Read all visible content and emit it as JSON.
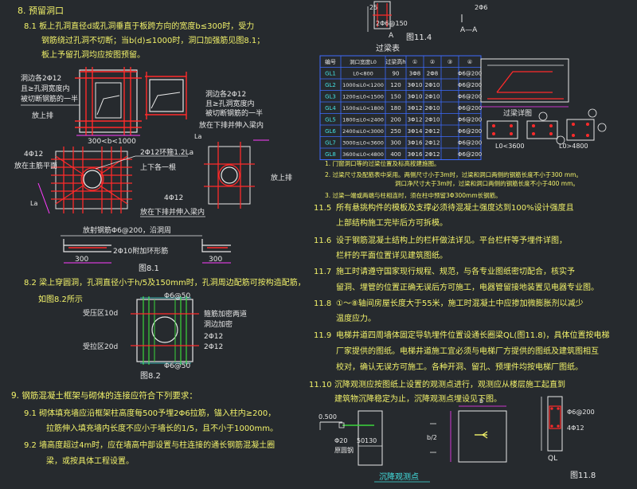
{
  "colors": {
    "background": "#262a2e",
    "rebar": "#ff2a2a",
    "outline": "#e8e8e8",
    "dimension": "#ff3dff",
    "note_text": "#f2f26a",
    "table_border": "#3d6bff",
    "cyan": "#43e0e0",
    "green": "#3bd63b"
  },
  "section8": {
    "title": "8.  预留洞口",
    "p81_line1": "8.1   板上孔洞直径d或孔洞垂直于板跨方向的宽度b≤300时，受力",
    "p81_line2": "钢筋绕过孔洞不切断；当b(d)≤1000时，洞口加强筋见图8.1；",
    "p81_line3": "板上予留孔洞均应按图预留。",
    "fig81_label_left1": "洞边各2Φ12",
    "fig81_label_left2": "且≥孔洞宽度内",
    "fig81_label_left3": "被切断钢筋的一半",
    "fig81_label_left4": "放上排",
    "fig81_label_right1": "洞边各2Φ12",
    "fig81_label_right2": "且≥孔洞宽度内",
    "fig81_label_right3": "被切断钢筋的一半",
    "fig81_label_right4": "放在下排并伸入梁内",
    "fig81_dim1": "300<b<1000",
    "fig81_ring": "2Φ12环箍1.2La",
    "fig81_up_down": "上下各一根",
    "fig81_4phi12_left": "4Φ12",
    "fig81_left_side": "放在主筋平面",
    "fig81_4phi12_right": "4Φ12",
    "fig81_right_side": "放在下排并伸入梁内",
    "fig81_upper": "放上排",
    "fig81_la": "La",
    "fig81_bottom_note1": "放射钢筋Φ6@200，沿洞周",
    "fig81_bottom_note2": "2Φ10附加环形筋",
    "fig81_dim300a": "300",
    "fig81_dim300b": "300",
    "fig81_caption": "图8.1",
    "p82_line1": "8.2   梁上穿圆洞，孔洞直径小于h/5及150mm时，孔洞周边配筋可按构造配筋，",
    "p82_line2": "如图8.2所示",
    "fig82_top": "Φ6@50",
    "fig82_mid1": "箍筋加密两道",
    "fig82_mid2": "洞边加密",
    "fig82_compression": "受压区10d",
    "fig82_tension": "受拉区20d",
    "fig82_2phi12": "2Φ12",
    "fig82_bottom": "Φ6@50",
    "fig82_caption": "图8.2"
  },
  "section9": {
    "title": "9.  钢筋混凝土框架与砌体的连接应符合下列要求：",
    "p91_line1": "9.1     砌体填充墙应沿框架柱高度每500予埋2Φ6拉筋，锚入柱内≥200，",
    "p91_line2": "拉筋伸入填充墙内长度不应小于墙长的1/5，且不小于1000mm。",
    "p92_line1": "9.2     墙高度超过4m时，应在墙高中部设置与柱连接的通长钢筋混凝土圈",
    "p92_line2": "梁，或按具体工程设置。"
  },
  "fig114": {
    "top_label": "2Φ6",
    "mid_label": "2Φ6@150",
    "mark_a": "A",
    "section_aa": "A—A",
    "caption": "图11.4",
    "dim_25": "25"
  },
  "lintel_table": {
    "title": "过梁表",
    "headers": [
      "编号",
      "洞口宽度L0",
      "过梁高h",
      "①",
      "②",
      "③",
      "④"
    ],
    "rows": [
      [
        "GL1",
        "L0<800",
        "90",
        "3Φ8",
        "2Φ8",
        "",
        "Φ6@200"
      ],
      [
        "GL2",
        "1000≤L0<1200",
        "120",
        "3Φ10",
        "2Φ10",
        "",
        "Φ6@200"
      ],
      [
        "GL3",
        "1200≤L0<1500",
        "150",
        "3Φ10",
        "2Φ10",
        "",
        "Φ6@200"
      ],
      [
        "GL4",
        "1500≤L0<1800",
        "180",
        "3Φ12",
        "2Φ10",
        "",
        "Φ6@200"
      ],
      [
        "GL5",
        "1800≤L0<2400",
        "200",
        "3Φ12",
        "2Φ10",
        "",
        "Φ6@200"
      ],
      [
        "GL6",
        "2400≤L0<3000",
        "250",
        "3Φ14",
        "2Φ12",
        "",
        "Φ6@200"
      ],
      [
        "GL7",
        "3000≤L0<3600",
        "300",
        "3Φ16",
        "2Φ12",
        "",
        "Φ6@200"
      ],
      [
        "GL8",
        "3600≤L0<4800",
        "400",
        "3Φ16",
        "2Φ12",
        "",
        "Φ6@200"
      ]
    ],
    "detail_caption": "过梁详图",
    "sec_label1": "L0<3600",
    "sec_label2": "L0>4800",
    "note1": "1.  门窗洞口等的过梁位置及标高按建施图。",
    "note2a": "2.  过梁尺寸及配筋表中采用。两侧尺寸小于3m时，过梁和洞口两侧的钢筋长度不小于300 mm。",
    "note2b": "洞口净尺寸大于3m时，过梁和洞口两侧的钢筋长度不小于400 mm。",
    "note3": "3.  过梁一端或两端与柱相连时，须在柱中预留3Φ300mm长钢筋。"
  },
  "section11": {
    "p115_num": "11.5",
    "p115_line1": "所有悬挑构件的模板及支撑必须待混凝土强度达到100%设计强度且",
    "p115_line2": "上部结构施工完毕后方可拆模。",
    "p116_num": "11.6",
    "p116_line1": "设于钢筋混凝土结构上的栏杆做法详见。平台栏杆等予埋件详图，",
    "p116_line2": "栏杆的平面位置详见建筑图纸。",
    "p117_num": "11.7",
    "p117_line1": "施工时请遵守国家现行规程、规范，与各专业图纸密切配合，核实予",
    "p117_line2": "留洞、埋管的位置正确无误后方可施工，电器管留接地装置见电器专业图。",
    "p118_num": "11.8",
    "p118_line1": "①～⑧轴间房屋长度大于55米，施工时混凝土中应掺加微膨胀剂以减少",
    "p118_line2": "温度应力。",
    "p119_num": "11.9",
    "p119_line1": "电梯井道四周墙体固定导轨埋件位置设通长圈梁QL(图11.8)，具体位置按电梯",
    "p119_line2": "厂家提供的图纸。电梯井道施工宜必须与电梯厂方提供的图纸及建筑图相互",
    "p119_line3": "校对，确认无误方可施工。各种开洞、留孔、预埋件均按电梯厂图纸。",
    "p1110_num": "11.10",
    "p1110_line1": "沉降观测应按图纸上设置的观测点进行，观测应从楼层施工起直到",
    "p1110_line2": "建筑物沉降稳定为止，沉降观测点埋设见下图。",
    "settle_caption": "沉降观测点",
    "settle_dim": "0.500",
    "settle_phi": "Φ20",
    "settle_label": "原圆钢",
    "settle_b": "b",
    "settle_b2": "b/2",
    "settle_50": "50",
    "settle_30": "130",
    "fig118_caption": "图11.8",
    "fig118_ql": "QL",
    "fig118_phi": "Φ6@200",
    "fig118_4phi": "4Φ12"
  }
}
